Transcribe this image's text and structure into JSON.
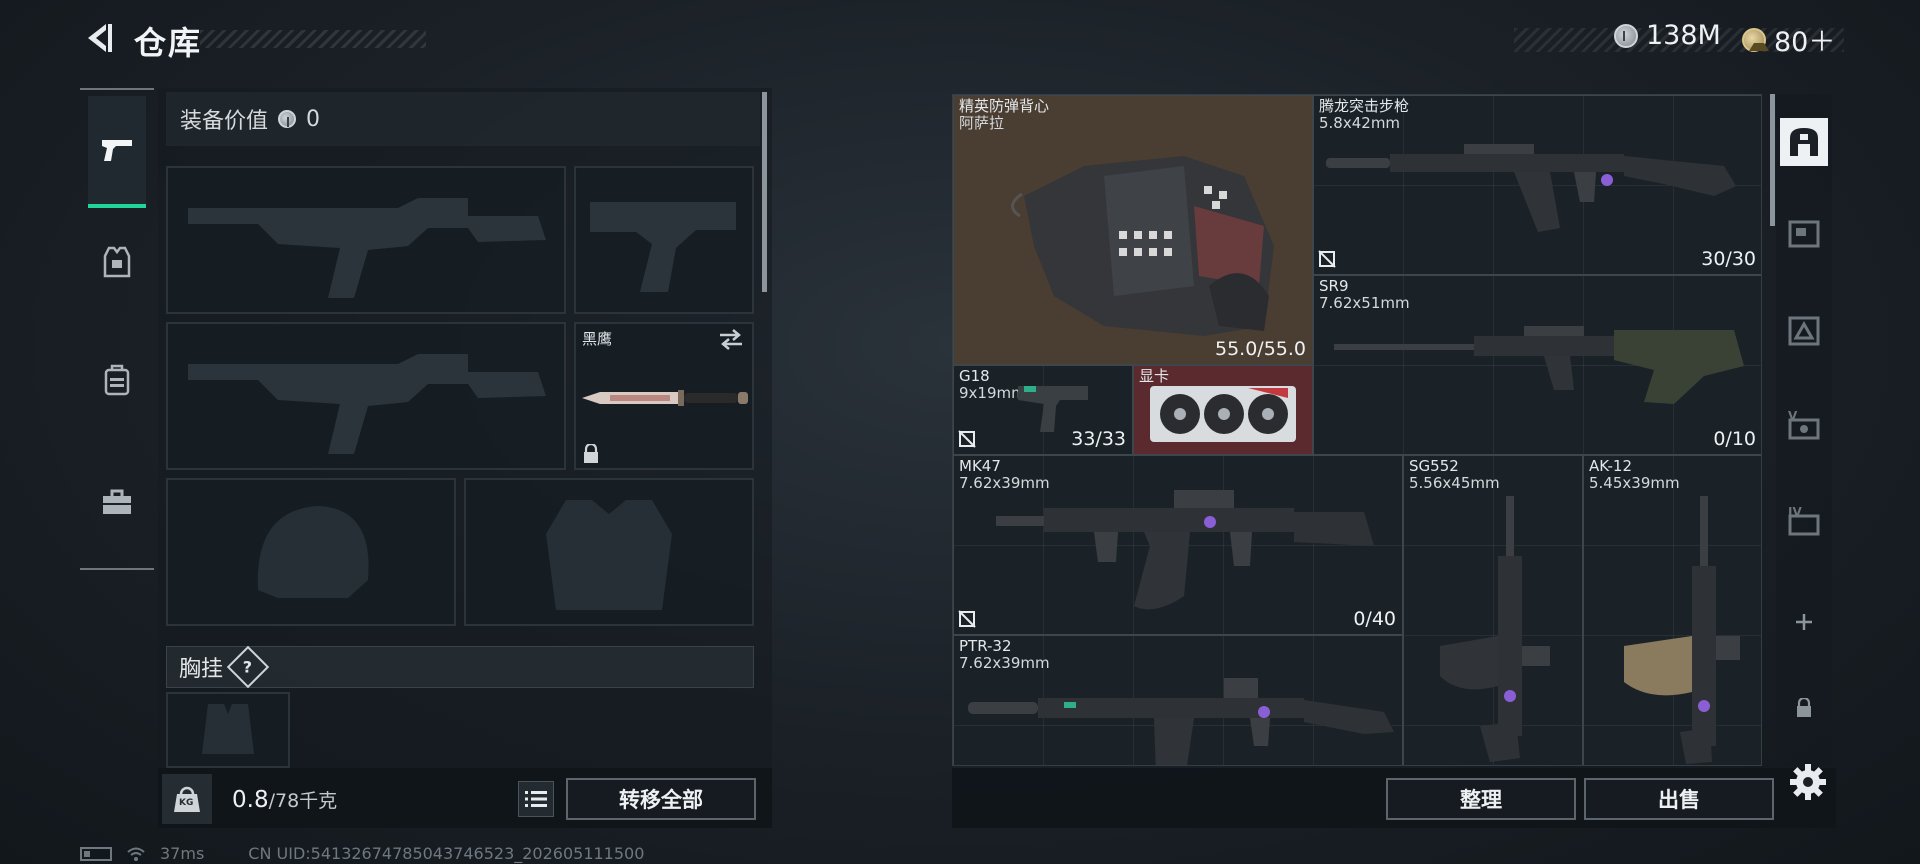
{
  "header": {
    "title": "仓库",
    "silver": "138M",
    "gold": "80＋"
  },
  "left_panel": {
    "equipment_value_label": "装备价值",
    "equipment_value": "0",
    "melee_slot_label": "黑鹰",
    "chest_rig_label": "胸挂",
    "chest_rig_help": "?",
    "weight_current": "0.8",
    "weight_max": "/78千克",
    "weight_icon_text": "KG",
    "transfer_all_label": "转移全部"
  },
  "stash_items": [
    {
      "name": "精英防弹背心",
      "sub": "阿萨拉",
      "count": "55.0/55.0",
      "no_trade": false,
      "bg": "#4a3d32"
    },
    {
      "name": "腾龙突击步枪",
      "sub": "5.8x42mm",
      "count": "30/30",
      "no_trade": true
    },
    {
      "name": "SR9",
      "sub": "7.62x51mm",
      "count": "0/10",
      "no_trade": false
    },
    {
      "name": "G18",
      "sub": "9x19mm",
      "count": "33/33",
      "no_trade": true
    },
    {
      "name": "显卡",
      "sub": "",
      "count": "",
      "no_trade": false,
      "bg": "#5a2a2e"
    },
    {
      "name": "MK47",
      "sub": "7.62x39mm",
      "count": "0/40",
      "no_trade": true
    },
    {
      "name": "SG552",
      "sub": "5.56x45mm",
      "count": "",
      "no_trade": false
    },
    {
      "name": "AK-12",
      "sub": "5.45x39mm",
      "count": "",
      "no_trade": false
    },
    {
      "name": "PTR-32",
      "sub": "7.62x39mm",
      "count": "",
      "no_trade": false
    }
  ],
  "right_panel": {
    "sort_label": "整理",
    "sell_label": "出售"
  },
  "status": {
    "ping": "37ms",
    "uid": "CN UID:54132674785043746523_202605111500"
  },
  "colors": {
    "accent_green": "#22d39a",
    "vest_bg": "#4a3d32",
    "gpu_bg": "#5a2a2e"
  }
}
